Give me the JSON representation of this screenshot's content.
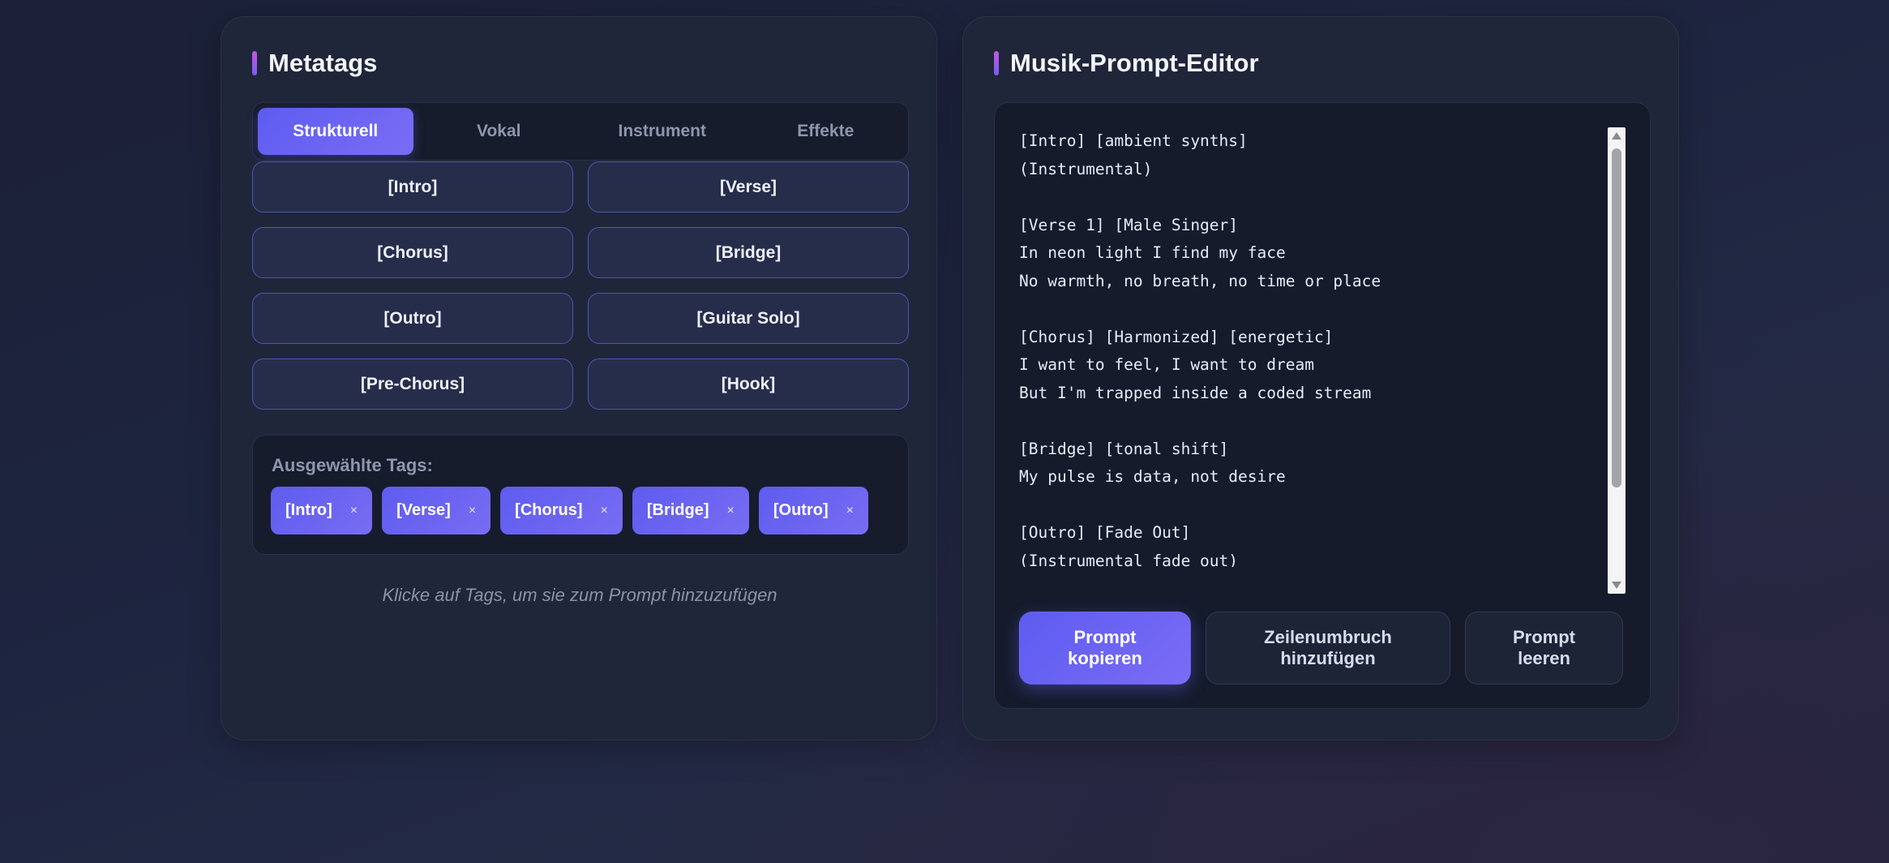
{
  "metatags": {
    "title": "Metatags",
    "tabs": [
      {
        "label": "Strukturell",
        "active": true
      },
      {
        "label": "Vokal",
        "active": false
      },
      {
        "label": "Instrument",
        "active": false
      },
      {
        "label": "Effekte",
        "active": false
      }
    ],
    "tag_buttons": [
      "[Intro]",
      "[Verse]",
      "[Chorus]",
      "[Bridge]",
      "[Outro]",
      "[Guitar Solo]",
      "[Pre-Chorus]",
      "[Hook]"
    ],
    "selected_label": "Ausgewählte Tags:",
    "selected_tags": [
      "[Intro]",
      "[Verse]",
      "[Chorus]",
      "[Bridge]",
      "[Outro]"
    ],
    "remove_glyph": "×",
    "hint": "Klicke auf Tags, um sie zum Prompt hinzuzufügen"
  },
  "editor": {
    "title": "Musik-Prompt-Editor",
    "prompt_text": "[Intro] [ambient synths]\n(Instrumental)\n\n[Verse 1] [Male Singer]\nIn neon light I find my face\nNo warmth, no breath, no time or place\n\n[Chorus] [Harmonized] [energetic]\nI want to feel, I want to dream\nBut I'm trapped inside a coded stream\n\n[Bridge] [tonal shift]\nMy pulse is data, not desire\n\n[Outro] [Fade Out]\n(Instrumental fade out)\n[Intro]",
    "buttons": {
      "copy": "Prompt\nkopieren",
      "linebreak": "Zeilenumbruch\nhinzufügen",
      "clear": "Prompt\nleeren"
    }
  },
  "colors": {
    "accent": "#6360f0",
    "panel": "#1f2639",
    "background": "#1c2237"
  }
}
